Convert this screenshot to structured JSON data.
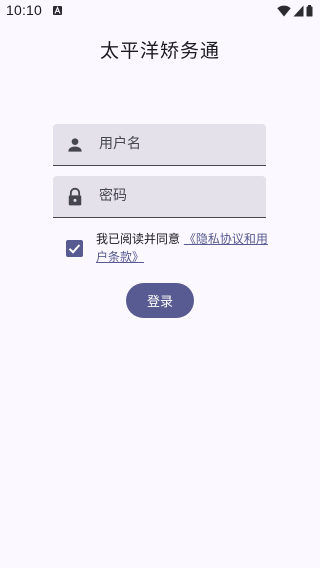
{
  "status_bar": {
    "time": "10:10"
  },
  "app": {
    "title": "太平洋矫务通"
  },
  "form": {
    "username_placeholder": "用户名",
    "password_placeholder": "密码",
    "agreement": {
      "checked": true,
      "prefix": "我已阅读并同意",
      "link_text": "《隐私协议和用户条款》"
    },
    "login_label": "登录"
  },
  "icons": {
    "username": "person-icon",
    "password": "lock-icon",
    "checkbox": "check-icon"
  },
  "colors": {
    "background": "#fbf8ff",
    "field": "#e4e1ea",
    "primary": "#585b91",
    "text": "#1b1b21"
  }
}
